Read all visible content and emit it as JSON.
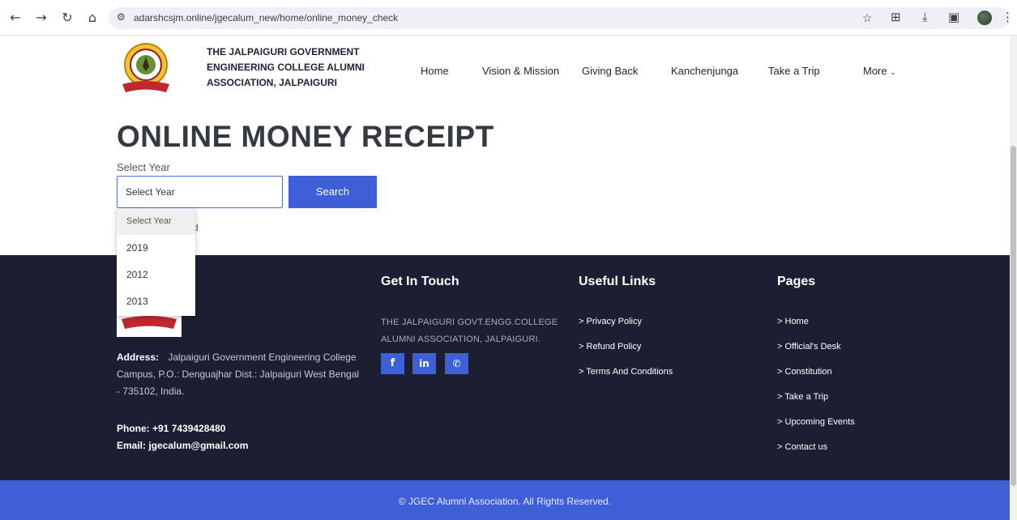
{
  "browser": {
    "url": "adarshcsjm.online/jgecalum_new/home/online_money_check",
    "icons": [
      "back-icon",
      "forward-icon",
      "reload-icon",
      "home-icon",
      "site-settings-icon",
      "star-icon",
      "extensions-icon",
      "download-icon",
      "sidepanel-icon",
      "profile-avatar",
      "menu-dots-icon"
    ]
  },
  "header": {
    "org_name": "THE JALPAIGURI GOVERNMENT ENGINEERING COLLEGE ALUMNI ASSOCIATION, JALPAIGURI",
    "logo_text": "ALUMNI ASSOCIATION",
    "nav": [
      "Home",
      "Vision & Mission",
      "Giving Back",
      "Kanchenjunga",
      "Take a Trip",
      "More"
    ]
  },
  "main": {
    "title": "ONLINE MONEY RECEIPT",
    "select_label": "Select Year",
    "select_value": "Select Year",
    "search_label": "Search",
    "partial_text": "d",
    "options": [
      "Select Year",
      "2019",
      "2012",
      "2013"
    ]
  },
  "footer": {
    "logo_text": "ALUMNI ASSOCIATION",
    "address_label": "Address:",
    "address": "Jalpaiguri Government Engineering College Campus, P.O.: Denguajhar Dist.: Jalpaiguri West Bengal - 735102, India.",
    "phone": "Phone: +91 7439428480",
    "email": "Email: jgecalum@gmail.com",
    "get_in_touch": {
      "heading": "Get In Touch",
      "text": "THE JALPAIGURI GOVT.ENGG.COLLEGE ALUMNI ASSOCIATION, JALPAIGURI.",
      "social": [
        "f",
        "in",
        "✆"
      ]
    },
    "useful_links": {
      "heading": "Useful Links",
      "items": [
        "Privacy Policy",
        "Refund Policy",
        "Terms And Conditions"
      ]
    },
    "pages": {
      "heading": "Pages",
      "items": [
        "Home",
        "Official's Desk",
        "Constitution",
        "Take a Trip",
        "Upcoming Events",
        "Contact us"
      ]
    },
    "copyright": "© JGEC Alumni Association. All Rights Reserved."
  },
  "colors": {
    "accent": "#3f5fd7",
    "footer_bg": "#1c1f33",
    "title": "#343a40"
  }
}
